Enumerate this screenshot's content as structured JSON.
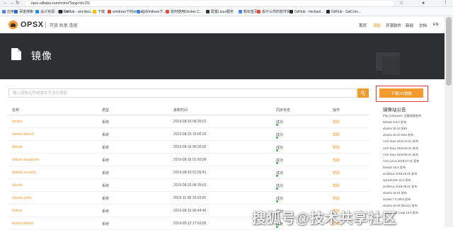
{
  "browser": {
    "url": "opsx.alibaba.com/mirror?lang=zh-CN",
    "bookmarks": [
      {
        "label": "应用",
        "color": "#4285f4"
      },
      {
        "label": "百度搜索",
        "color": "#2a6ad9"
      },
      {
        "label": "设计资源 - Ant De...",
        "color": "#1890ff"
      },
      {
        "label": "GitHub - ant-desi...",
        "color": "#24292e"
      },
      {
        "label": "下载",
        "color": "#f0c000"
      },
      {
        "label": "windows下的docke...",
        "color": "#e84a3c"
      },
      {
        "label": "在Windows下...",
        "color": "#2d8cf0"
      },
      {
        "label": "如何使用Docker C...",
        "color": "#e84a3c"
      },
      {
        "label": "配置Linux服务",
        "color": "#333333"
      },
      {
        "label": "新标签页",
        "color": "#4285f4"
      },
      {
        "label": "看什么你的软件实...",
        "color": "#e84a3c"
      },
      {
        "label": "GitHub - michael...",
        "color": "#24292e"
      },
      {
        "label": "GitHub - SaiCren...",
        "color": "#24292e"
      }
    ]
  },
  "header": {
    "logo": "OPSX",
    "slogan": "开放 共享 连接",
    "nav": [
      {
        "label": "首页",
        "active": false
      },
      {
        "label": "镜像",
        "active": true
      },
      {
        "label": "开源软件",
        "active": false
      },
      {
        "label": "新闻",
        "active": false
      },
      {
        "label": "文档",
        "active": false
      },
      {
        "label": "EN",
        "active": false
      }
    ]
  },
  "banner": {
    "title": "镜像"
  },
  "search": {
    "placeholder": "输入镜像名称或版本号进行搜索"
  },
  "table": {
    "columns": [
      "名称",
      "类型",
      "最新时间",
      "同步状态",
      "操作"
    ],
    "rows": [
      {
        "name": "centos",
        "type": "系统",
        "time": "2019-08-16 06:35:01",
        "status": "成功",
        "op": "帮助"
      },
      {
        "name": "centos-altarch",
        "type": "系统",
        "time": "2019-08-16 10:06:29",
        "status": "成功",
        "op": "帮助"
      },
      {
        "name": "debian",
        "type": "系统",
        "time": "2019-08-16 06:35:00",
        "status": "成功",
        "op": "帮助"
      },
      {
        "name": "debian-backports",
        "type": "系统",
        "time": "2019-08-16 01:50:09",
        "status": "成功",
        "op": "帮助"
      },
      {
        "name": "debian-security",
        "type": "系统",
        "time": "2019-08-16 01:35:41",
        "status": "成功",
        "op": "帮助"
      },
      {
        "name": "ubuntu",
        "type": "系统",
        "time": "2019-08-16 06:35:01",
        "status": "成功",
        "op": "帮助"
      },
      {
        "name": "ubuntu-ports",
        "type": "系统",
        "time": "2019-11-08 15:00:06",
        "status": "成功",
        "op": "帮助"
      },
      {
        "name": "fedora",
        "type": "系统",
        "time": "2019-08-16 06:44:45",
        "status": "成功",
        "op": "帮助"
      },
      {
        "name": "fedora-altarch",
        "type": "系统",
        "time": "2019-05-12 17:03:05",
        "status": "成功",
        "op": "帮助"
      }
    ]
  },
  "sidebar": {
    "download_label": "下载OS镜像",
    "notice_title": "镜像站公告",
    "notices": [
      "Php Composer 全量镜像发布",
      "Debian 9.6.0 发布",
      "ubuntu 16.10 发布",
      "ubuntu 16.10 beta 发布",
      "Arch linux 2018.10.01 发布",
      "Arch linux 2018.09.01 发布",
      "Arch linux 2018.08.01 发布",
      "Arch Linux 2018.07.01 发布",
      "Deepin 15.6 发布",
      "archlinux 2018.06.01 发布",
      "openSUSE 15.0 发布",
      "archlinux 2018.05.01 发布",
      "ubuntu 18.04 发布",
      "centos 7.5.1804 发布",
      "ubuntu 18.04 (bionic) 发布",
      "openSUSE Leap 15.0 发布"
    ]
  },
  "watermark": "搜狐号@技术共享社区"
}
